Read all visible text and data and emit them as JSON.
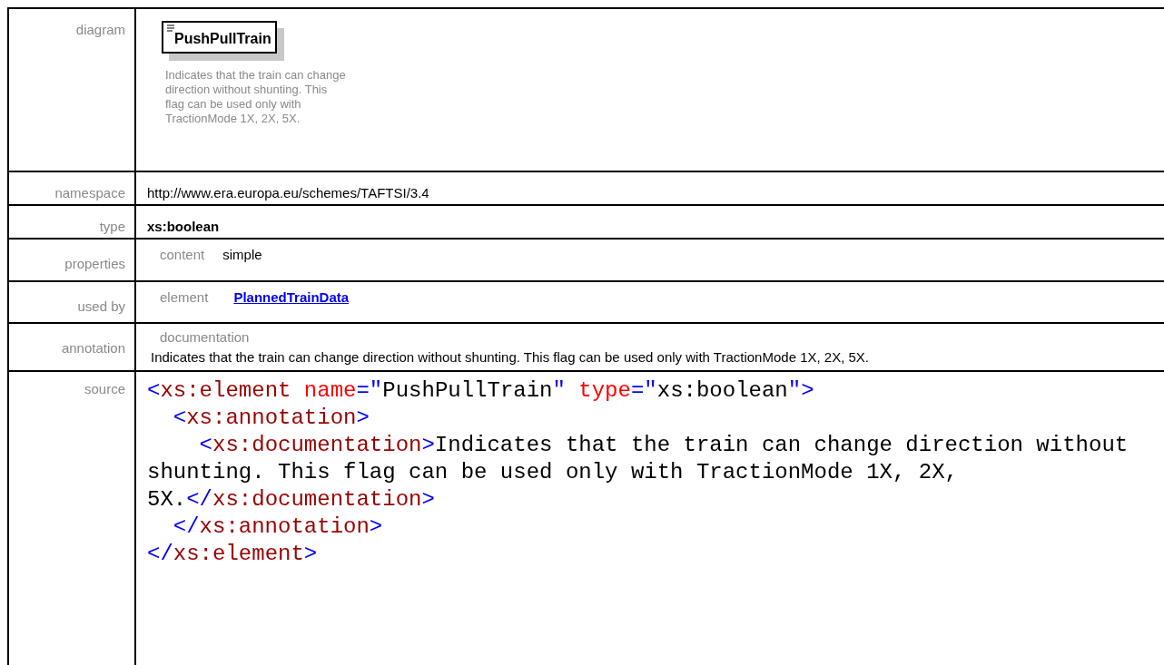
{
  "rows": [
    {
      "kind": "diagram",
      "label": "diagram",
      "element_name": "PushPullTrain",
      "description": "Indicates that the train can change direction without shunting. This flag can be used only with TractionMode 1X, 2X, 5X."
    },
    {
      "kind": "text",
      "label": "namespace",
      "value": "http://www.era.europa.eu/schemes/TAFTSI/3.4"
    },
    {
      "kind": "bold",
      "label": "type",
      "value": "xs:boolean"
    },
    {
      "kind": "pair",
      "label": "properties",
      "key": "content",
      "value": "simple"
    },
    {
      "kind": "link",
      "label": "used by",
      "key": "element",
      "value": "PlannedTrainData"
    },
    {
      "kind": "doc",
      "label": "annotation",
      "key": "documentation",
      "value": "Indicates that the train can change direction without shunting. This flag can be used only with TractionMode 1X, 2X, 5X."
    },
    {
      "kind": "code",
      "label": "source",
      "lines": [
        [
          {
            "kind": "punct",
            "text": "<"
          },
          {
            "kind": "tag",
            "text": "xs:element"
          },
          {
            "kind": "attr",
            "text": " name"
          },
          {
            "kind": "punct",
            "text": "=\""
          },
          {
            "kind": "plain",
            "text": "PushPullTrain"
          },
          {
            "kind": "punct",
            "text": "\""
          },
          {
            "kind": "attr",
            "text": " type"
          },
          {
            "kind": "punct",
            "text": "=\""
          },
          {
            "kind": "plain",
            "text": "xs:boolean"
          },
          {
            "kind": "punct",
            "text": "\">"
          }
        ],
        [
          {
            "kind": "punct",
            "text": "  <"
          },
          {
            "kind": "tag",
            "text": "xs:annotation"
          },
          {
            "kind": "punct",
            "text": ">"
          }
        ],
        [
          {
            "kind": "punct",
            "text": "    <"
          },
          {
            "kind": "tag",
            "text": "xs:documentation"
          },
          {
            "kind": "punct",
            "text": ">"
          },
          {
            "kind": "plain",
            "text": "Indicates that the train can change direction without"
          }
        ],
        [
          {
            "kind": "plain",
            "text": "shunting. This flag can be used only with TractionMode 1X, 2X,"
          }
        ],
        [
          {
            "kind": "plain",
            "text": "5X."
          },
          {
            "kind": "punct",
            "text": "</"
          },
          {
            "kind": "tag",
            "text": "xs:documentation"
          },
          {
            "kind": "punct",
            "text": ">"
          }
        ],
        [
          {
            "kind": "punct",
            "text": "  </"
          },
          {
            "kind": "tag",
            "text": "xs:annotation"
          },
          {
            "kind": "punct",
            "text": ">"
          }
        ],
        [
          {
            "kind": "punct",
            "text": "</"
          },
          {
            "kind": "tag",
            "text": "xs:element"
          },
          {
            "kind": "punct",
            "text": ">"
          }
        ]
      ]
    }
  ]
}
